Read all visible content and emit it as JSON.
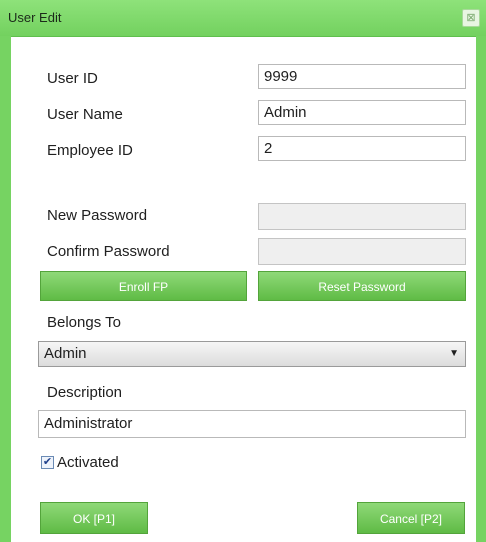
{
  "dialog": {
    "title": "User Edit",
    "close_icon": "close-icon",
    "close_glyph": "⊠"
  },
  "form": {
    "user_id_label": "User ID",
    "user_id_value": "9999",
    "user_name_label": "User Name",
    "user_name_value": "Admin",
    "employee_id_label": "Employee ID",
    "employee_id_value": "2",
    "new_password_label": "New Password",
    "new_password_value": "",
    "confirm_password_label": "Confirm Password",
    "confirm_password_value": "",
    "enroll_fp_label": "Enroll FP",
    "reset_password_label": "Reset Password",
    "belongs_to_label": "Belongs To",
    "belongs_to_value": "Admin",
    "description_label": "Description",
    "description_value": "Administrator",
    "activated_label": "Activated",
    "activated_checked": true
  },
  "footer": {
    "ok_label": "OK [P1]",
    "cancel_label": "Cancel [P2]"
  },
  "colors": {
    "accent_green": "#76d362",
    "button_green": "#5fbb45"
  }
}
